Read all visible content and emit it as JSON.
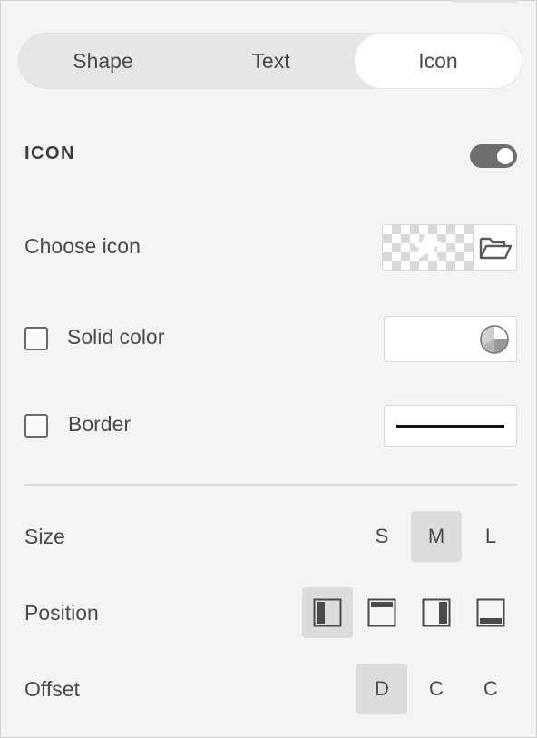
{
  "tabs": [
    {
      "label": "Shape",
      "selected": false
    },
    {
      "label": "Text",
      "selected": false
    },
    {
      "label": "Icon",
      "selected": true
    }
  ],
  "icon_section": {
    "title": "ICON",
    "enabled": true,
    "choose_icon_label": "Choose icon",
    "solid_color_label": "Solid color",
    "solid_color_checked": false,
    "border_label": "Border",
    "border_checked": false
  },
  "size": {
    "label": "Size",
    "options": [
      "S",
      "M",
      "L"
    ],
    "selected": "M"
  },
  "position": {
    "label": "Position",
    "options": [
      "left-align-icon",
      "top-align-icon",
      "right-align-icon",
      "bottom-align-icon"
    ],
    "selected": "left-align-icon"
  },
  "offset": {
    "label": "Offset",
    "options": [
      "D",
      "C",
      "C"
    ],
    "selected_index": 0
  },
  "colors": {
    "panel_bg": "#f4f4f4",
    "selected_bg": "#dcdcdc",
    "toggle_on": "#6e6e6e"
  }
}
